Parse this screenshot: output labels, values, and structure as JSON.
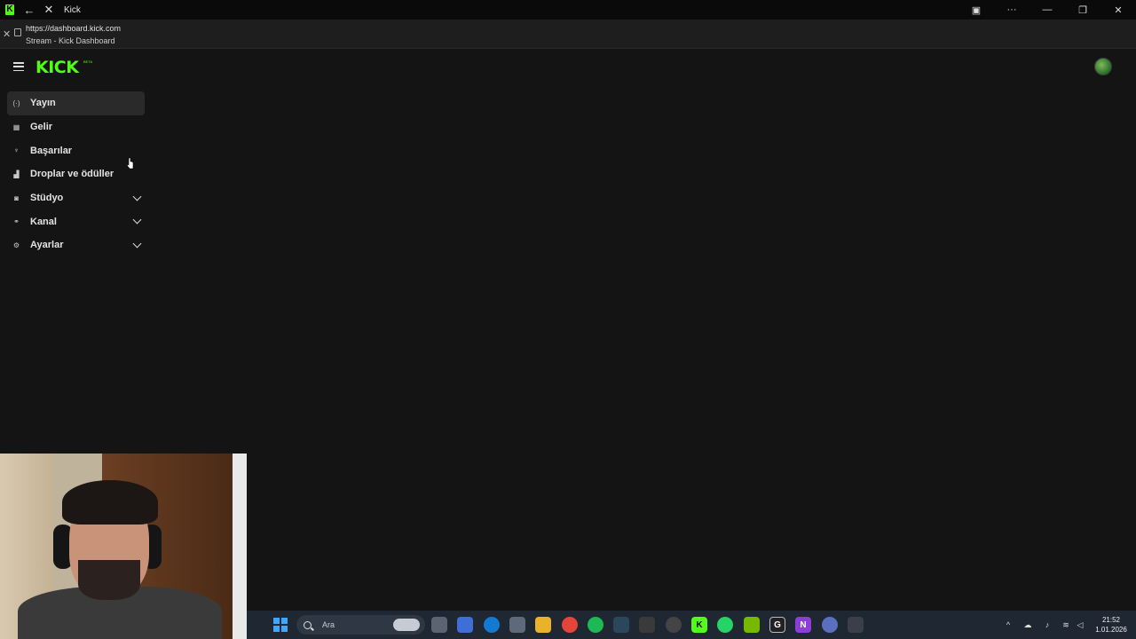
{
  "window": {
    "title": "Kick"
  },
  "address": {
    "url": "https://dashboard.kick.com",
    "page_title": "Stream - Kick Dashboard"
  },
  "app": {
    "logo": "KICK",
    "logo_badge": "BETA"
  },
  "sidebar": {
    "items": [
      {
        "label": "Yayın",
        "icon": "broadcast-icon"
      },
      {
        "label": "Gelir",
        "icon": "revenue-icon"
      },
      {
        "label": "Başarılar",
        "icon": "trophy-icon"
      },
      {
        "label": "Droplar ve ödüller",
        "icon": "gift-icon"
      },
      {
        "label": "Stüdyo",
        "icon": "studio-icon"
      },
      {
        "label": "Kanal",
        "icon": "channel-icon"
      },
      {
        "label": "Ayarlar",
        "icon": "gear-icon"
      }
    ]
  },
  "taskbar": {
    "search_placeholder": "Ara",
    "time": "21:52",
    "date": "1.01.2026"
  },
  "colors": {
    "brand": "#53fc18",
    "background": "#141414",
    "active_item": "#2a2a2a"
  }
}
